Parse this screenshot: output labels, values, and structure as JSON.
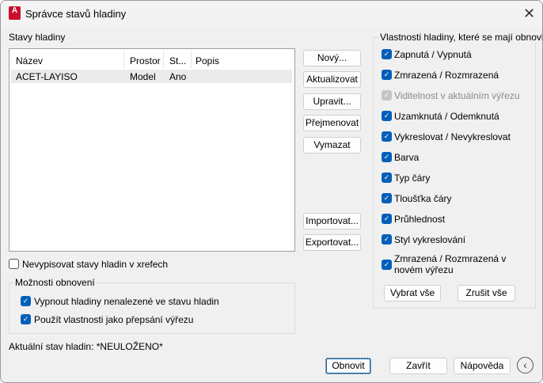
{
  "window": {
    "title": "Správce stavů hladiny",
    "logo_text": "A",
    "close_icon": "close-icon"
  },
  "states": {
    "label": "Stavy hladiny",
    "columns": [
      "Název",
      "Prostor",
      "St...",
      "Popis"
    ],
    "rows": [
      {
        "name": "ACET-LAYISO",
        "space": "Model",
        "state": "Ano",
        "desc": ""
      }
    ]
  },
  "buttons": {
    "new": "Nový...",
    "update": "Aktualizovat",
    "edit": "Upravit...",
    "rename": "Přejmenovat",
    "delete": "Vymazat",
    "import": "Importovat...",
    "export": "Exportovat..."
  },
  "xref_checkbox": {
    "label": "Nevypisovat stavy hladin v xrefech",
    "checked": false
  },
  "restore_options": {
    "label": "Možnosti obnovení",
    "items": [
      {
        "label": "Vypnout hladiny nenalezené ve stavu hladin",
        "checked": true
      },
      {
        "label": "Použít vlastnosti jako přepsání výřezu",
        "checked": true
      }
    ]
  },
  "status": "Aktuální stav hladin: *NEULOŽENO*",
  "properties": {
    "label": "Vlastnosti hladiny, které se mají obnovit",
    "items": [
      {
        "label": "Zapnutá / Vypnutá",
        "checked": true,
        "enabled": true
      },
      {
        "label": "Zmrazená / Rozmrazená",
        "checked": true,
        "enabled": true
      },
      {
        "label": "Viditelnost v aktuálním výřezu",
        "checked": true,
        "enabled": false
      },
      {
        "label": "Uzamknutá / Odemknutá",
        "checked": true,
        "enabled": true
      },
      {
        "label": "Vykreslovat / Nevykreslovat",
        "checked": true,
        "enabled": true
      },
      {
        "label": "Barva",
        "checked": true,
        "enabled": true
      },
      {
        "label": "Typ čáry",
        "checked": true,
        "enabled": true
      },
      {
        "label": "Tloušťka čáry",
        "checked": true,
        "enabled": true
      },
      {
        "label": "Průhlednost",
        "checked": true,
        "enabled": true
      },
      {
        "label": "Styl vykreslování",
        "checked": true,
        "enabled": true
      },
      {
        "label": "Zmrazená / Rozmrazená v novém výřezu",
        "checked": true,
        "enabled": true
      }
    ],
    "select_all": "Vybrat vše",
    "clear_all": "Zrušit vše"
  },
  "footer": {
    "restore": "Obnovit",
    "close": "Zavřít",
    "help": "Nápověda",
    "collapse_icon": "chevron-left-icon"
  }
}
